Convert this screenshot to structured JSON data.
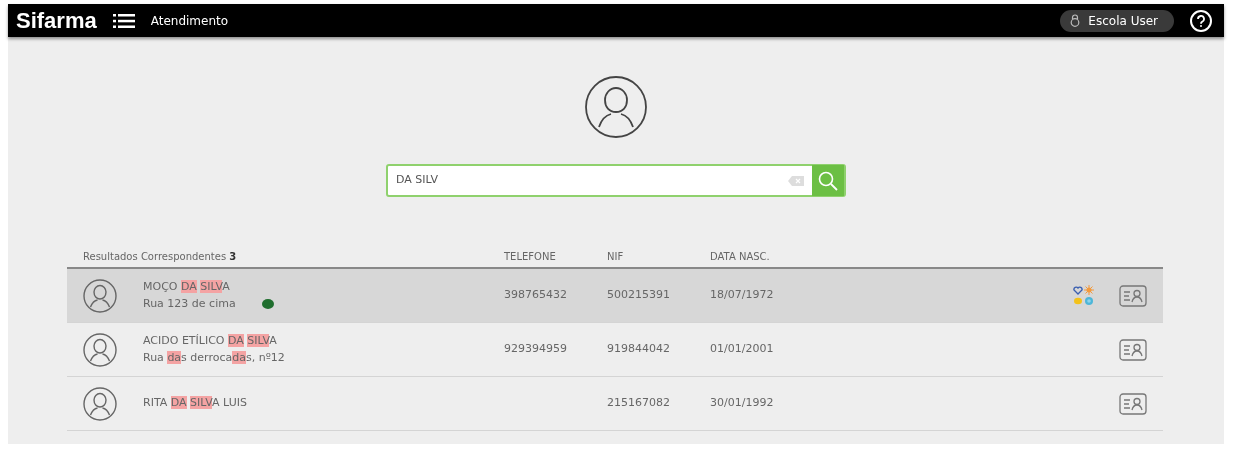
{
  "topbar": {
    "logo": "Sifarma",
    "section": "Atendimento",
    "user": "Escola User"
  },
  "search": {
    "value": "DA SILV"
  },
  "results": {
    "label": "Resultados Correspondentes",
    "count": "3",
    "columns": [
      "TELEFONE",
      "NIF",
      "DATA NASC."
    ]
  },
  "rows": [
    {
      "hovered": true,
      "status_dot": true,
      "program_icons": true,
      "name": [
        {
          "text": "MOÇO ",
          "match": false
        },
        {
          "text": "DA ",
          "match": true
        },
        {
          "text": "SILV",
          "match": true
        },
        {
          "text": "A",
          "match": false
        }
      ],
      "address": [
        {
          "text": "Rua 123 de cima",
          "match": false
        }
      ],
      "phone": "398765432",
      "nif": "500215391",
      "birth": "18/07/1972"
    },
    {
      "hovered": false,
      "status_dot": false,
      "program_icons": false,
      "name": [
        {
          "text": "ACIDO ETÍLICO ",
          "match": false
        },
        {
          "text": "DA ",
          "match": true
        },
        {
          "text": "SILV",
          "match": true
        },
        {
          "text": "A",
          "match": false
        }
      ],
      "address": [
        {
          "text": "Rua ",
          "match": false
        },
        {
          "text": "da",
          "match": true
        },
        {
          "text": "s derroca",
          "match": false
        },
        {
          "text": "da",
          "match": true
        },
        {
          "text": "s, nº12",
          "match": false
        }
      ],
      "phone": "929394959",
      "nif": "919844042",
      "birth": "01/01/2001"
    },
    {
      "hovered": false,
      "status_dot": false,
      "program_icons": false,
      "name": [
        {
          "text": "RITA ",
          "match": false
        },
        {
          "text": "DA ",
          "match": true
        },
        {
          "text": "SILV",
          "match": true
        },
        {
          "text": "A LUIS",
          "match": false
        }
      ],
      "address": [],
      "phone": "",
      "nif": "215167082",
      "birth": "30/01/1992"
    }
  ]
}
